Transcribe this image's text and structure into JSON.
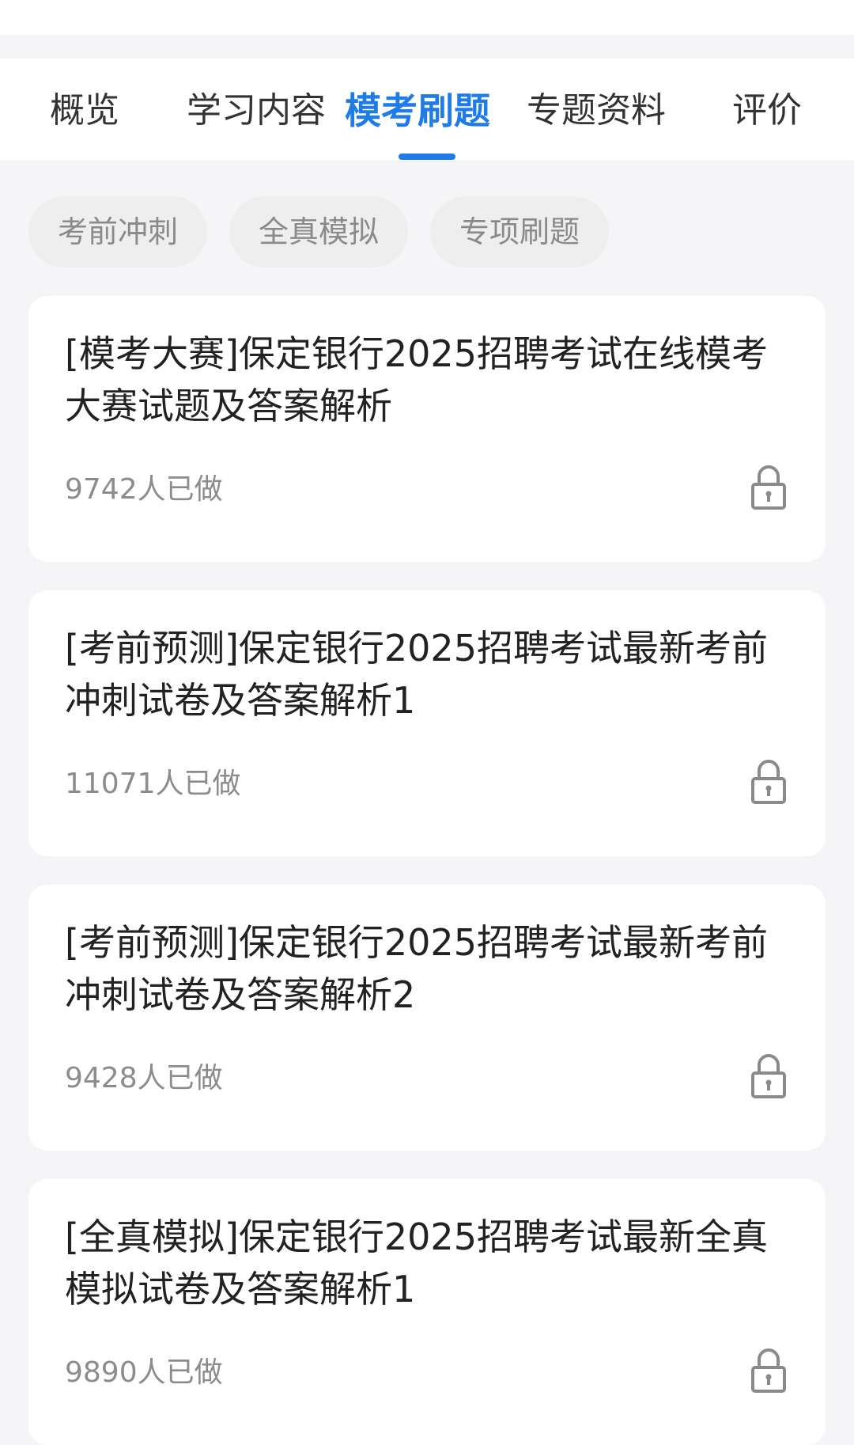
{
  "tabs": [
    {
      "label": "概览"
    },
    {
      "label": "学习内容"
    },
    {
      "label": "模考刷题"
    },
    {
      "label": "专题资料"
    },
    {
      "label": "评价"
    }
  ],
  "active_tab": "模考刷题",
  "filters": [
    {
      "label": "考前冲刺"
    },
    {
      "label": "全真模拟"
    },
    {
      "label": "专项刷题"
    }
  ],
  "papers": [
    {
      "title": "[模考大赛]保定银行2025招聘考试在线模考大赛试题及答案解析",
      "count": "9742人已做",
      "icon": "lock-icon"
    },
    {
      "title": "[考前预测]保定银行2025招聘考试最新考前冲刺试卷及答案解析1",
      "count": "11071人已做",
      "icon": "lock-icon"
    },
    {
      "title": "[考前预测]保定银行2025招聘考试最新考前冲刺试卷及答案解析2",
      "count": "9428人已做",
      "icon": "lock-icon"
    },
    {
      "title": "[全真模拟]保定银行2025招聘考试最新全真模拟试卷及答案解析1",
      "count": "9890人已做",
      "icon": "lock-icon"
    }
  ],
  "colors": {
    "accent": "#1f7be6",
    "background": "#f5f5f7",
    "card": "#ffffff",
    "chip": "#eeeeef",
    "muted_text": "#8c8c8c"
  }
}
